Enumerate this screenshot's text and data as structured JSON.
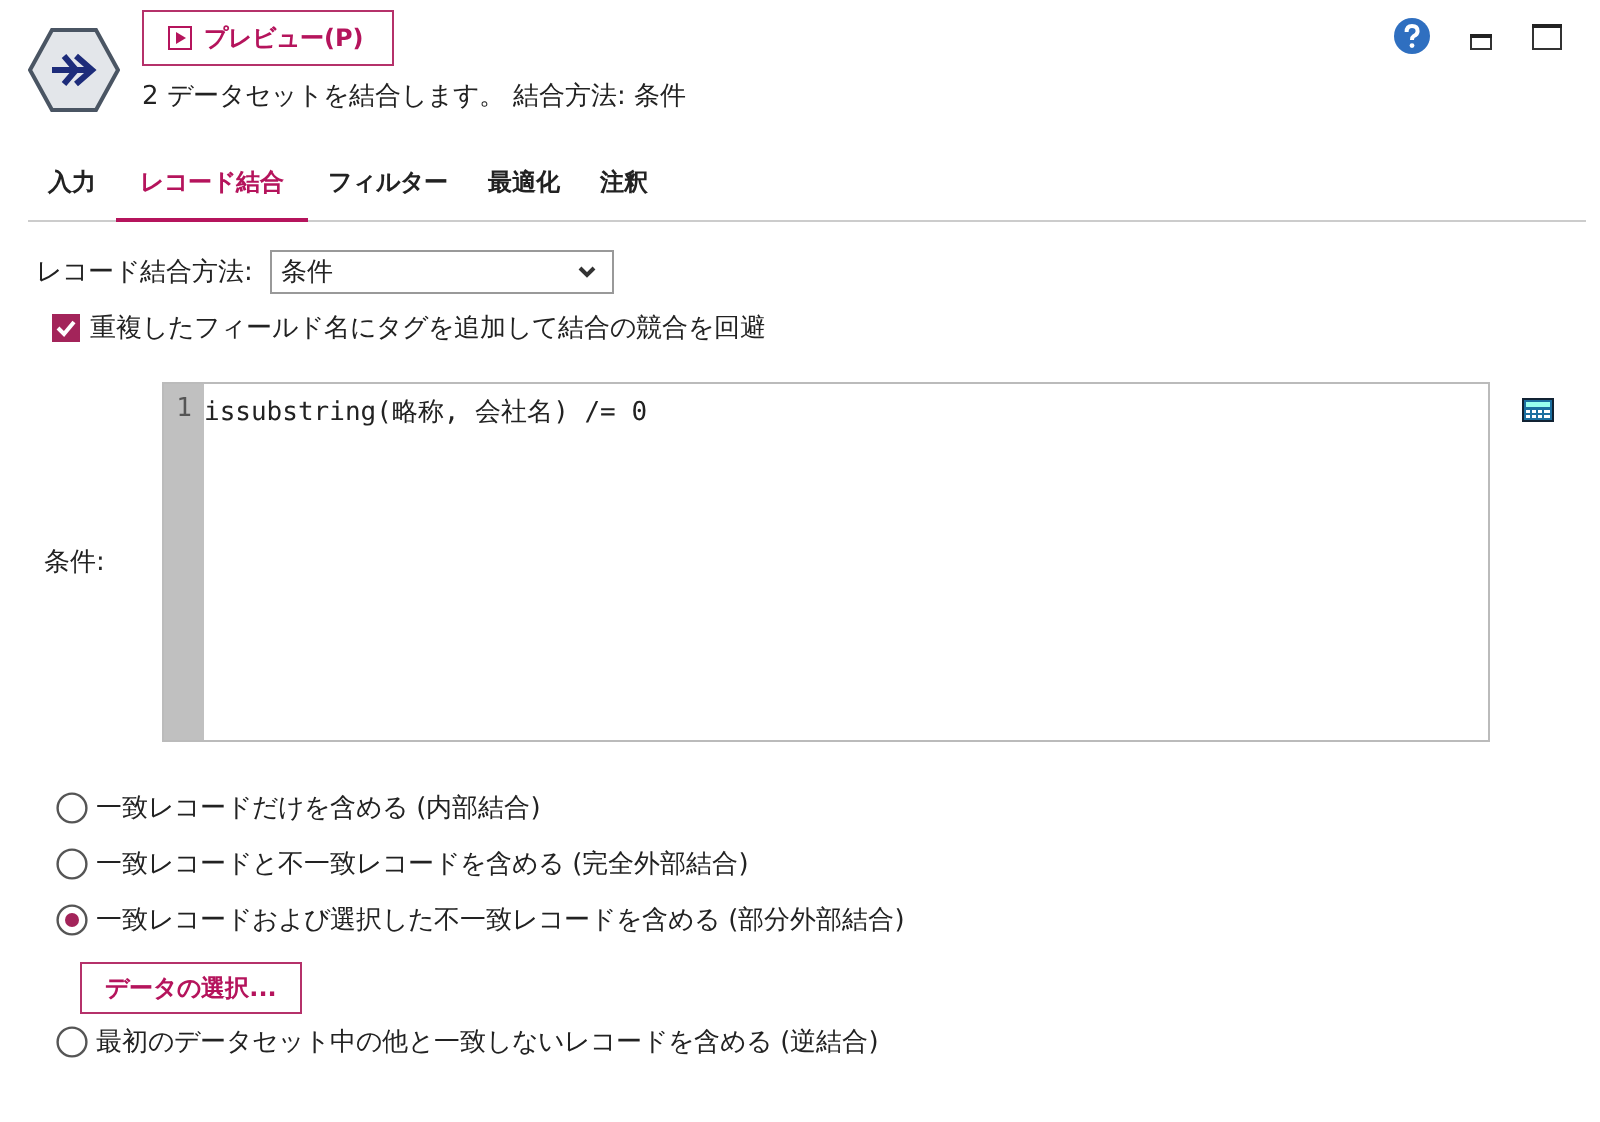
{
  "header": {
    "preview_button": "プレビュー(P)",
    "summary": "2 データセットを結合します。 結合方法: 条件"
  },
  "tabs": [
    {
      "label": "入力",
      "selected": false
    },
    {
      "label": "レコード結合",
      "selected": true
    },
    {
      "label": "フィルター",
      "selected": false
    },
    {
      "label": "最適化",
      "selected": false
    },
    {
      "label": "注釈",
      "selected": false
    }
  ],
  "method": {
    "label": "レコード結合方法:",
    "value": "条件"
  },
  "tag_option": {
    "label": "重複したフィールド名にタグを追加して結合の競合を回避",
    "checked": true
  },
  "condition": {
    "label": "条件:",
    "lines": [
      {
        "number": "1",
        "code": "issubstring(略称, 会社名) /= 0"
      }
    ]
  },
  "join_types": [
    {
      "label": "一致レコードだけを含める (内部結合)",
      "selected": false
    },
    {
      "label": "一致レコードと不一致レコードを含める (完全外部結合)",
      "selected": false
    },
    {
      "label": "一致レコードおよび選択した不一致レコードを含める (部分外部結合)",
      "selected": true,
      "button": "データの選択..."
    },
    {
      "label": "最初のデータセット中の他と一致しないレコードを含める (逆結合)",
      "selected": false
    }
  ]
}
